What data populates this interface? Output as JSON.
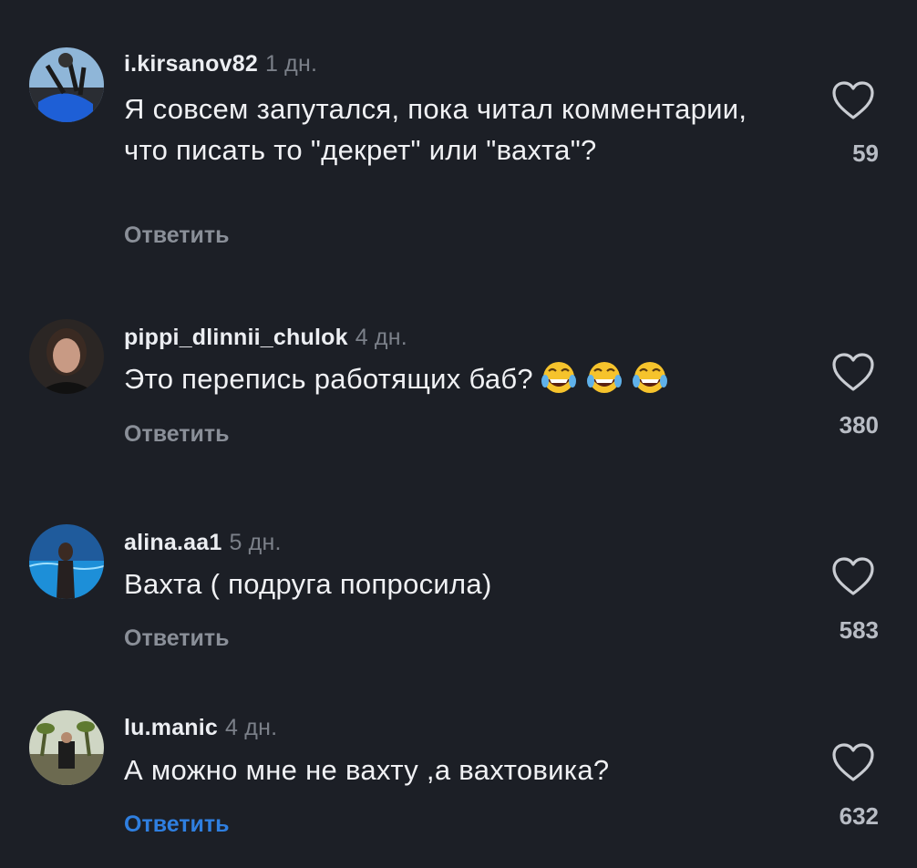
{
  "comments": [
    {
      "username": "i.kirsanov82",
      "time": "1 дн.",
      "text": "Я совсем запутался, пока читал комментарии, что писать то \"декрет\" или \"вахта\"?",
      "reply_label": "Ответить",
      "likes": "59"
    },
    {
      "username": "pippi_dlinnii_chulok",
      "time": "4 дн.",
      "text": "Это перепись работящих баб?",
      "emoji": "😂😂😂",
      "reply_label": "Ответить",
      "likes": "380"
    },
    {
      "username": "alina.aa1",
      "time": "5 дн.",
      "text": "Вахта ( подруга попросила)",
      "reply_label": "Ответить",
      "likes": "583"
    },
    {
      "username": "lu.manic",
      "time": "4 дн.",
      "text": "А можно мне не вахту ,а вахтовика?",
      "reply_label": "Ответить",
      "likes": "632"
    }
  ],
  "colors": {
    "background": "#1c1f26",
    "secondary_text": "#8a8f98",
    "reply_active": "#2f7fe0"
  },
  "icons": {
    "like": "heart-outline-icon"
  }
}
